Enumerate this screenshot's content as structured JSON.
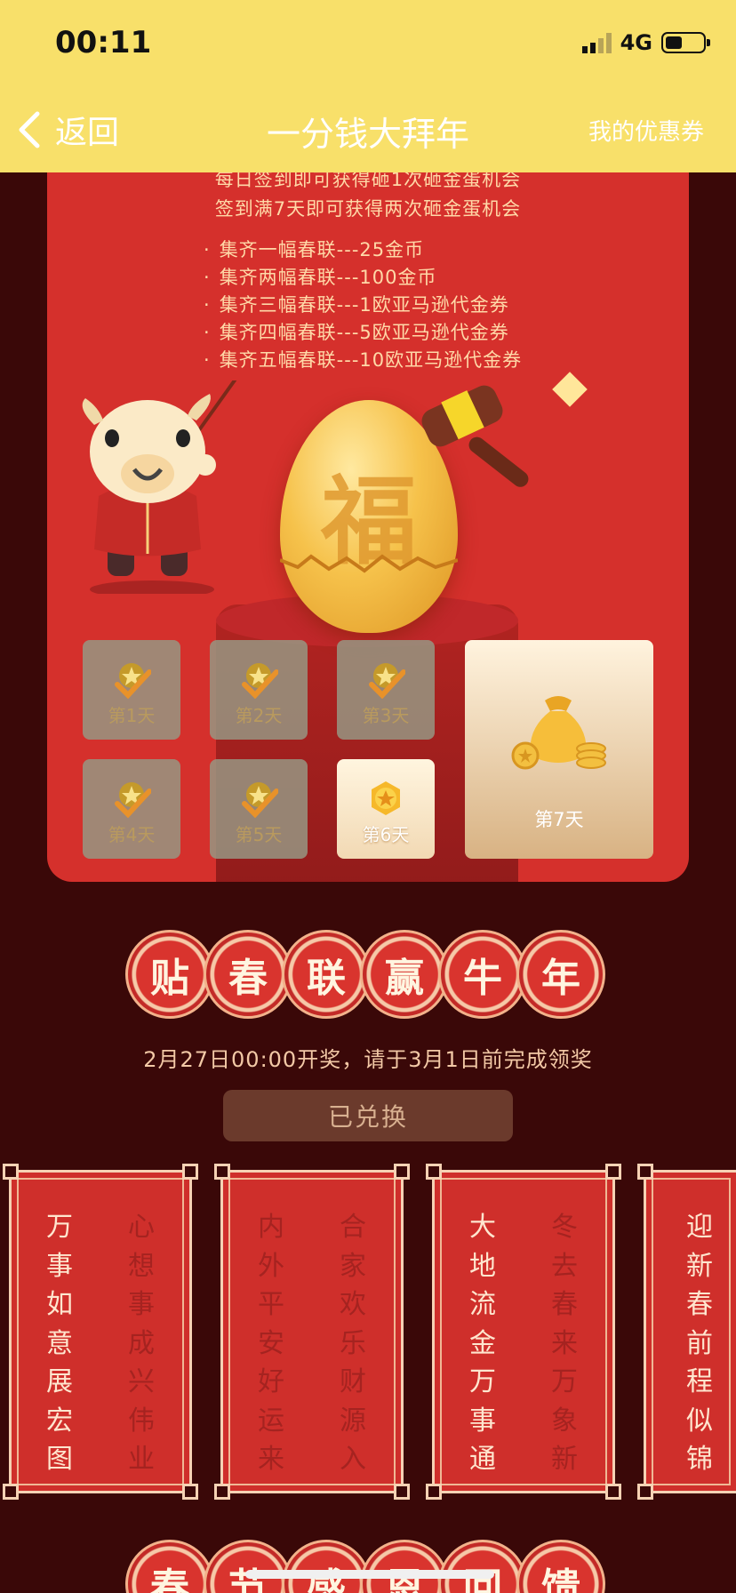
{
  "status_bar": {
    "time": "00:11",
    "network": "4G"
  },
  "nav": {
    "back_label": "返回",
    "title": "一分钱大拜年",
    "coupon_label": "我的优惠券"
  },
  "rules": {
    "line1": "每日签到即可获得砸1次砸金蛋机会",
    "line2": "签到满7天即可获得两次砸金蛋机会",
    "items": [
      "集齐一幅春联---25金币",
      "集齐两幅春联---100金币",
      "集齐三幅春联---1欧亚马逊代金券",
      "集齐四幅春联---5欧亚马逊代金券",
      "集齐五幅春联---10欧亚马逊代金券"
    ]
  },
  "egg_char": "福",
  "days": [
    {
      "label": "第1天",
      "status": "done"
    },
    {
      "label": "第2天",
      "status": "done"
    },
    {
      "label": "第3天",
      "status": "done"
    },
    {
      "label": "第4天",
      "status": "done"
    },
    {
      "label": "第5天",
      "status": "done"
    },
    {
      "label": "第6天",
      "status": "active"
    },
    {
      "label": "第7天",
      "status": "reward"
    }
  ],
  "headline": [
    "贴",
    "春",
    "联",
    "赢",
    "牛",
    "年"
  ],
  "draw_note": "2月27日00:00开奖，请于3月1日前完成领奖",
  "redeem_label": "已兑换",
  "couplets": [
    {
      "left": "万事如意展宏图",
      "right": "心想事成兴伟业",
      "left_style": "light",
      "right_style": "dark"
    },
    {
      "left": "内外平安好运来",
      "right": "合家欢乐财源入",
      "left_style": "dark",
      "right_style": "dark"
    },
    {
      "left": "大地流金万事通",
      "right": "冬去春来万象新",
      "left_style": "light",
      "right_style": "dark"
    },
    {
      "left": "迎新春前程似锦",
      "right": "",
      "left_style": "light",
      "right_style": "dark"
    }
  ],
  "bottom_headline": [
    "春",
    "节",
    "感",
    "恩",
    "回",
    "馈"
  ],
  "colors": {
    "nav_bg": "#f8e06a",
    "page_bg": "#3a0808",
    "card_red": "#d5302c",
    "gold": "#f6c24b"
  }
}
